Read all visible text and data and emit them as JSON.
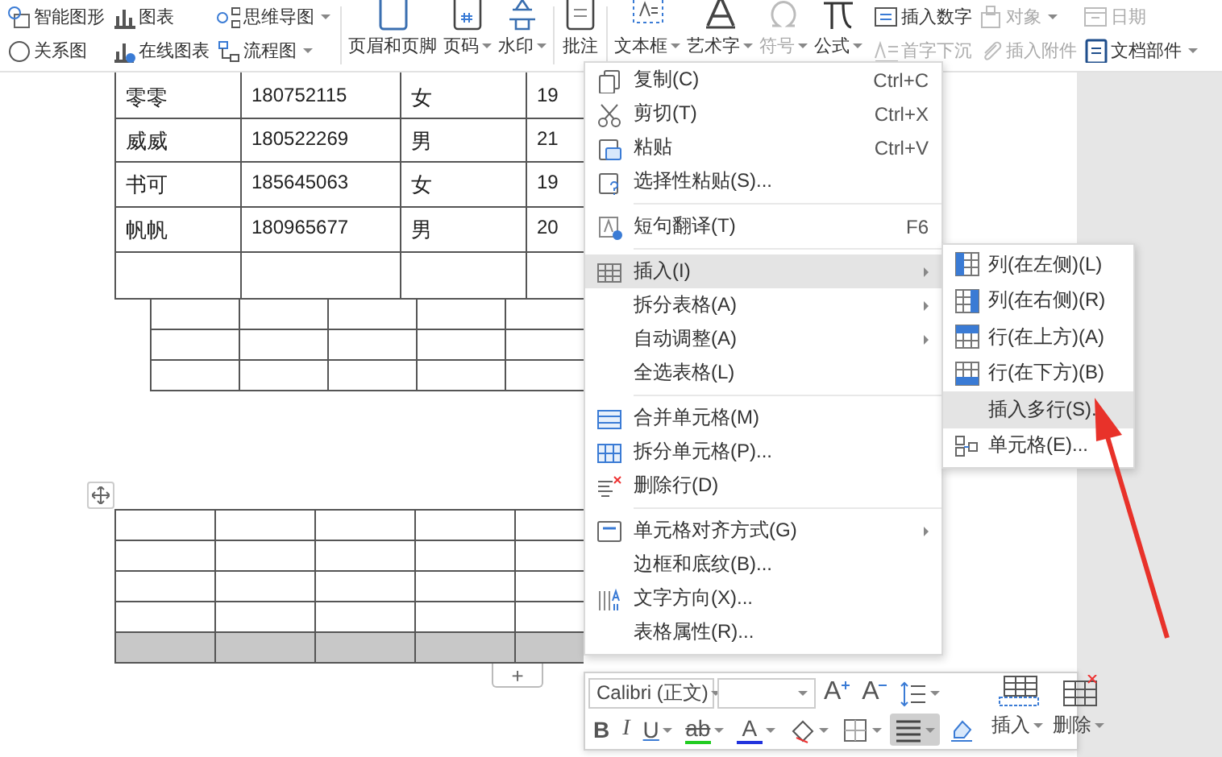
{
  "ribbon": {
    "small_tools": [
      {
        "label": "智能图形",
        "dropdown": false
      },
      {
        "label": "图表",
        "dropdown": false
      },
      {
        "label": "思维导图",
        "dropdown": true
      },
      {
        "label": "关系图",
        "dropdown": false
      },
      {
        "label": "在线图表",
        "dropdown": false
      },
      {
        "label": "流程图",
        "dropdown": true
      }
    ],
    "large_tools": [
      {
        "label": "页眉和页脚",
        "dropdown": false,
        "disabled": false
      },
      {
        "label": "页码",
        "dropdown": true,
        "disabled": false
      },
      {
        "label": "水印",
        "dropdown": true,
        "disabled": false
      },
      {
        "label": "批注",
        "dropdown": false,
        "disabled": false
      },
      {
        "label": "文本框",
        "dropdown": true,
        "disabled": false
      },
      {
        "label": "艺术字",
        "dropdown": true,
        "disabled": false
      },
      {
        "label": "符号",
        "dropdown": true,
        "disabled": true
      },
      {
        "label": "公式",
        "dropdown": true,
        "disabled": false
      }
    ],
    "right_tools": [
      {
        "label": "插入数字",
        "dropdown": false,
        "disabled": false
      },
      {
        "label": "对象",
        "dropdown": true,
        "disabled": true
      },
      {
        "label": "日期",
        "dropdown": false,
        "disabled": true
      },
      {
        "label": "首字下沉",
        "dropdown": false,
        "disabled": true
      },
      {
        "label": "插入附件",
        "dropdown": false,
        "disabled": true
      },
      {
        "label": "文档部件",
        "dropdown": true,
        "disabled": false
      }
    ]
  },
  "document": {
    "tables": [
      {
        "rows": [
          {
            "selected": false,
            "cells": [
              "零零",
              "180752115",
              "女",
              "19"
            ]
          },
          {
            "selected": false,
            "cells": [
              "威威",
              "180522269",
              "男",
              "21"
            ]
          },
          {
            "selected": false,
            "cells": [
              "书可",
              "185645063",
              "女",
              "19"
            ]
          },
          {
            "selected": false,
            "cells": [
              "帆帆",
              "180965677",
              "男",
              "20"
            ]
          },
          {
            "selected": false
          }
        ]
      },
      {
        "rows": [
          {
            "selected": false
          },
          {
            "selected": false
          },
          {
            "selected": false
          }
        ]
      },
      {
        "rows": [
          {
            "selected": false
          },
          {
            "selected": false
          },
          {
            "selected": false
          },
          {
            "selected": false
          },
          {
            "selected": true
          }
        ]
      }
    ],
    "add_row_button": "+"
  },
  "context_menu": {
    "items": [
      {
        "kind": "item",
        "label": "复制(C)",
        "shortcut": "Ctrl+C",
        "submenu": false,
        "selected": false
      },
      {
        "kind": "item",
        "label": "剪切(T)",
        "shortcut": "Ctrl+X",
        "submenu": false,
        "selected": false
      },
      {
        "kind": "item",
        "label": "粘贴",
        "shortcut": "Ctrl+V",
        "submenu": false,
        "selected": false
      },
      {
        "kind": "item",
        "label": "选择性粘贴(S)...",
        "submenu": false,
        "selected": false
      },
      {
        "kind": "separator"
      },
      {
        "kind": "item",
        "label": "短句翻译(T)",
        "shortcut": "F6",
        "submenu": false,
        "selected": false
      },
      {
        "kind": "separator"
      },
      {
        "kind": "item",
        "label": "插入(I)",
        "submenu": true,
        "selected": true
      },
      {
        "kind": "item",
        "label": "拆分表格(A)",
        "submenu": true,
        "selected": false
      },
      {
        "kind": "item",
        "label": "自动调整(A)",
        "submenu": true,
        "selected": false
      },
      {
        "kind": "item",
        "label": "全选表格(L)",
        "submenu": false,
        "selected": false
      },
      {
        "kind": "separator"
      },
      {
        "kind": "item",
        "label": "合并单元格(M)",
        "submenu": false,
        "selected": false
      },
      {
        "kind": "item",
        "label": "拆分单元格(P)...",
        "submenu": false,
        "selected": false
      },
      {
        "kind": "item",
        "label": "删除行(D)",
        "submenu": false,
        "selected": false
      },
      {
        "kind": "separator"
      },
      {
        "kind": "item",
        "label": "单元格对齐方式(G)",
        "submenu": true,
        "selected": false
      },
      {
        "kind": "item",
        "label": "边框和底纹(B)...",
        "submenu": false,
        "selected": false
      },
      {
        "kind": "item",
        "label": "文字方向(X)...",
        "submenu": false,
        "selected": false
      },
      {
        "kind": "item",
        "label": "表格属性(R)...",
        "submenu": false,
        "selected": false
      }
    ]
  },
  "submenu": {
    "items": [
      {
        "label": "列(在左侧)(L)",
        "selected": false
      },
      {
        "label": "列(在右侧)(R)",
        "selected": false
      },
      {
        "label": "行(在上方)(A)",
        "selected": false
      },
      {
        "label": "行(在下方)(B)",
        "selected": false
      },
      {
        "label": "插入多行(S).",
        "selected": true
      },
      {
        "label": "单元格(E)...",
        "selected": false
      }
    ]
  },
  "mini_toolbar": {
    "font": "Calibri (正文)",
    "row_1": [
      {
        "kind": "grow",
        "label": "A",
        "dropdown": false
      },
      {
        "kind": "shrink",
        "label": "A",
        "dropdown": false
      },
      {
        "kind": "spacing",
        "dropdown": true
      }
    ],
    "row_2": [
      {
        "kind": "bold",
        "label": "B",
        "dropdown": false,
        "selected": false
      },
      {
        "kind": "italic",
        "label": "I",
        "dropdown": false,
        "selected": false
      },
      {
        "kind": "underline",
        "label": "U",
        "dropdown": true,
        "selected": false
      },
      {
        "kind": "highlight",
        "label": "ab",
        "dropdown": true,
        "selected": false
      },
      {
        "kind": "font_color",
        "label": "A",
        "dropdown": true,
        "selected": false
      },
      {
        "kind": "shading",
        "dropdown": true,
        "selected": false
      },
      {
        "kind": "borders",
        "dropdown": true,
        "selected": false
      },
      {
        "kind": "align",
        "dropdown": true,
        "selected": true
      },
      {
        "kind": "eraser",
        "dropdown": false,
        "selected": false
      }
    ],
    "big_buttons": [
      {
        "kind": "insert",
        "label": "插入",
        "dropdown": true
      },
      {
        "kind": "delete",
        "label": "删除",
        "dropdown": true
      }
    ]
  },
  "annotations": [
    {
      "kind": "arrow"
    }
  ]
}
